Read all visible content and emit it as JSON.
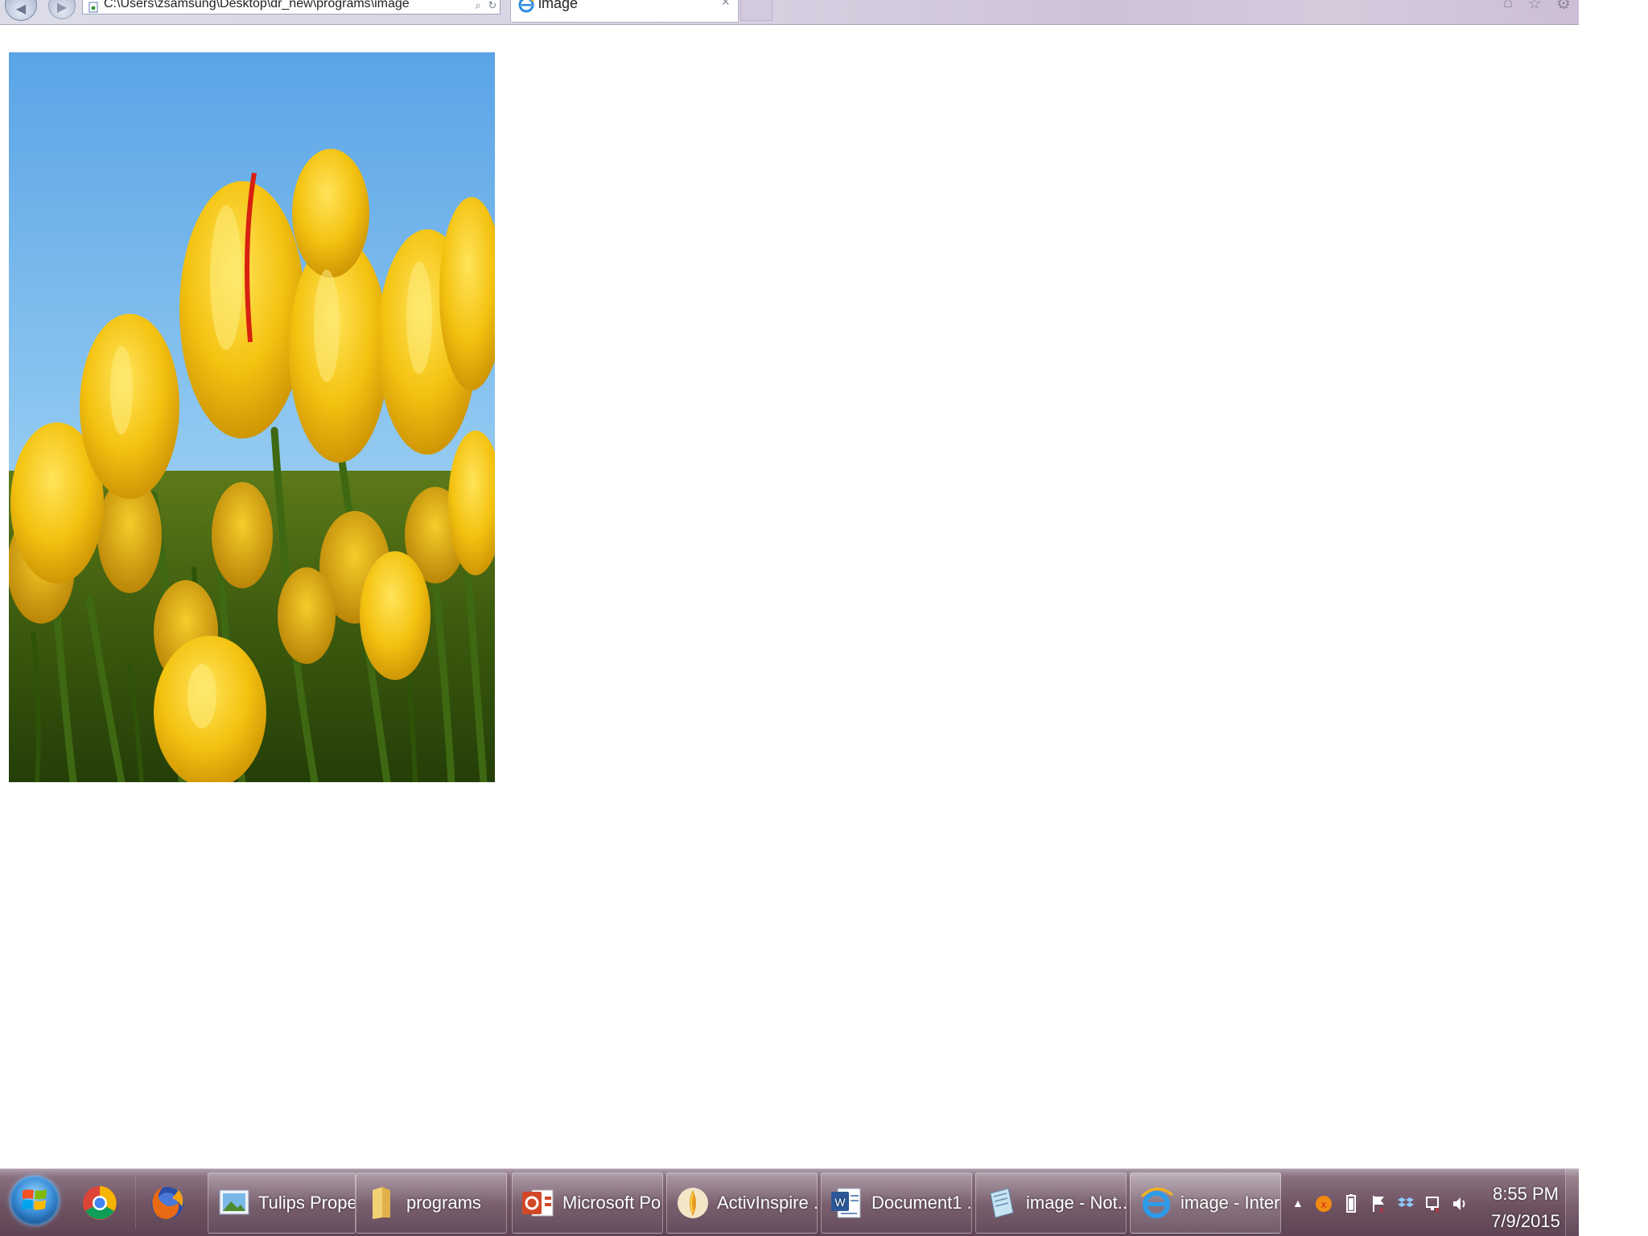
{
  "browser": {
    "address": "C:\\Users\\zsamsung\\Desktop\\dr_new\\programs\\image",
    "tab_title": "image",
    "tab_close": "×"
  },
  "page": {
    "image_description_icon": "tulip-photo"
  },
  "taskbar": {
    "pinned": [
      {
        "name": "chrome-icon"
      },
      {
        "name": "firefox-icon"
      }
    ],
    "windows": [
      {
        "label": "Tulips Prope...",
        "icon": "image-properties-icon",
        "active": false
      },
      {
        "label": "programs",
        "icon": "folder-icon",
        "active": false
      },
      {
        "label": "Microsoft Po...",
        "icon": "powerpoint-icon",
        "active": false
      },
      {
        "label": "ActivInspire ...",
        "icon": "activinspire-icon",
        "active": false
      },
      {
        "label": "Document1 ...",
        "icon": "word-icon",
        "active": false
      },
      {
        "label": "image - Not...",
        "icon": "notepad-icon",
        "active": false
      },
      {
        "label": "image - Inter...",
        "icon": "internet-explorer-icon",
        "active": true
      }
    ],
    "clock": {
      "time": "8:55 PM",
      "date": "7/9/2015"
    }
  },
  "colors": {
    "taskbar": "#6e5262",
    "tulip": "#f2c20e",
    "sky": "#74b8ec"
  }
}
